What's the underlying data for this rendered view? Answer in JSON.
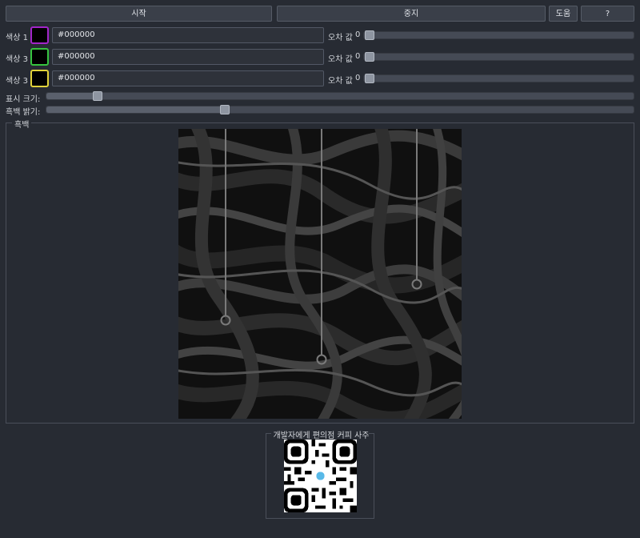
{
  "toolbar": {
    "start_label": "시작",
    "stop_label": "중지",
    "help_label": "도움",
    "question_label": "?"
  },
  "color_rows": [
    {
      "label": "색상 1",
      "border_color": "#a325c9",
      "hex": "#000000",
      "tolerance_label": "오차 값",
      "tolerance_value": "0"
    },
    {
      "label": "색상 3",
      "border_color": "#37c43f",
      "hex": "#000000",
      "tolerance_label": "오차 값",
      "tolerance_value": "0"
    },
    {
      "label": "색상 3",
      "border_color": "#e1d33b",
      "hex": "#000000",
      "tolerance_label": "오차 값",
      "tolerance_value": "0"
    }
  ],
  "display_size": {
    "label": "표시 크기:",
    "level": 0.08
  },
  "bw_brightness": {
    "label": "흑백 밝기:",
    "level": 0.3
  },
  "preview": {
    "title": "흑백"
  },
  "donate": {
    "title": "개발자에게 편의점 커피 사주기"
  },
  "colors": {
    "background": "#272b33",
    "button": "#3a3f49",
    "slider_handle": "#8e95a1"
  },
  "icons": {
    "qr": "qr-code-icon"
  }
}
